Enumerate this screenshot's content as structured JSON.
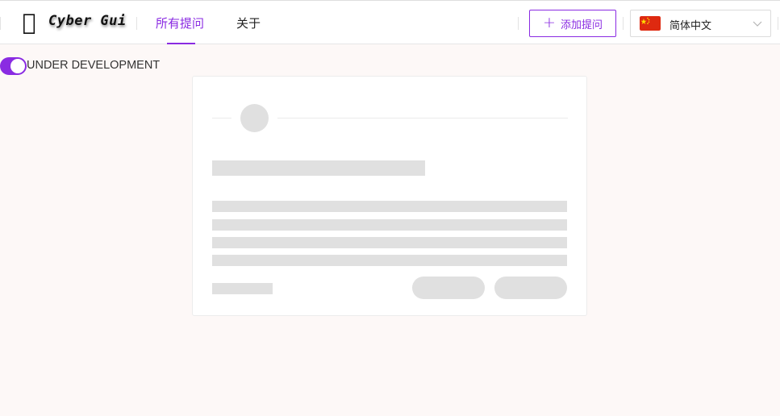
{
  "header": {
    "logo_glyph": "𠠵",
    "app_name": "Cyber Gui",
    "nav": [
      {
        "label": "所有提问",
        "active": true
      },
      {
        "label": "关于",
        "active": false
      }
    ],
    "add_question_label": "添加提问",
    "language": {
      "selected": "简体中文",
      "flag": "cn-flag-icon"
    }
  },
  "status": {
    "toggle_on": true,
    "label": "UNDER DEVELOPMENT"
  },
  "colors": {
    "accent": "#8a2be2",
    "skeleton": "#e0e0e0",
    "background": "#fdf8f7"
  }
}
